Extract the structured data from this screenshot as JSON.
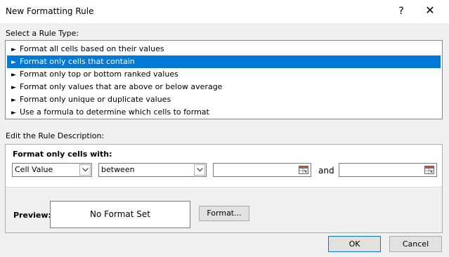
{
  "window": {
    "title": "New Formatting Rule",
    "help_glyph": "?",
    "close_glyph": "✕"
  },
  "rule_type": {
    "label": "Select a Rule Type:",
    "items": [
      {
        "label": "Format all cells based on their values",
        "selected": false
      },
      {
        "label": "Format only cells that contain",
        "selected": true
      },
      {
        "label": "Format only top or bottom ranked values",
        "selected": false
      },
      {
        "label": "Format only values that are above or below average",
        "selected": false
      },
      {
        "label": "Format only unique or duplicate values",
        "selected": false
      },
      {
        "label": "Use a formula to determine which cells to format",
        "selected": false
      }
    ]
  },
  "description": {
    "label": "Edit the Rule Description:",
    "format_only_label": "Format only cells with:",
    "condition_type": "Cell Value",
    "operator": "between",
    "value1": "",
    "and_label": "and",
    "value2": "",
    "preview_label": "Preview:",
    "preview_text": "No Format Set",
    "format_button": "Format..."
  },
  "buttons": {
    "ok": "OK",
    "cancel": "Cancel"
  },
  "colors": {
    "selection": "#0078d7",
    "background": "#f0f0f0"
  },
  "icons": {
    "arrow": "rule-arrow-icon",
    "ref": "range-select-icon",
    "dropdown": "chevron-down-icon"
  }
}
